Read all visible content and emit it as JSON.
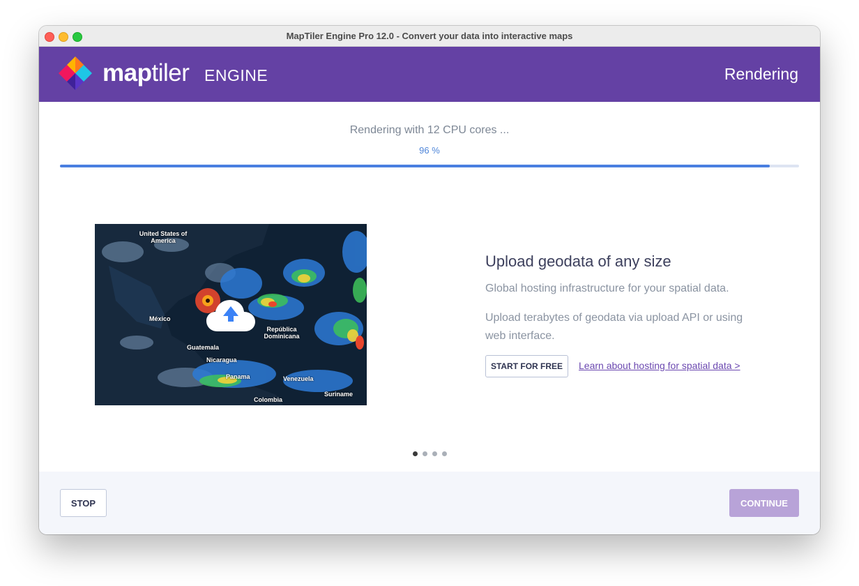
{
  "window": {
    "title": "MapTiler Engine Pro 12.0 - Convert your data into interactive maps"
  },
  "header": {
    "brand_map": "map",
    "brand_tiler": "tiler",
    "brand_engine": "ENGINE",
    "status": "Rendering"
  },
  "progress": {
    "label": "Rendering with 12 CPU cores ...",
    "percent_text": "96 %",
    "percent": 96,
    "bar_color": "#4a7fe0",
    "track_color": "#dde4f2"
  },
  "slide": {
    "title": "Upload geodata of any size",
    "description": "Global hosting infrastructure for your spatial data.",
    "description2": "Upload terabytes of geodata via upload API or using web interface.",
    "cta_label": "START FOR FREE",
    "link_text": "Learn about hosting for spatial data >",
    "map_labels": {
      "usa": "United States of America",
      "mexico": "México",
      "guatemala": "Guatemala",
      "nicaragua": "Nicaragua",
      "panama": "Panama",
      "republica": "República Dominicana",
      "venezuela": "Venezuela",
      "colombia": "Colombia",
      "suriname": "Suriname"
    }
  },
  "carousel": {
    "count": 4,
    "active_index": 0
  },
  "footer": {
    "stop_label": "STOP",
    "continue_label": "CONTINUE"
  },
  "colors": {
    "header_bg": "#6441a4",
    "continue_bg": "#b8a3d8",
    "link": "#6b48b0"
  },
  "icons": {
    "upload": "cloud-upload-icon",
    "logo": "maptiler-logo"
  }
}
